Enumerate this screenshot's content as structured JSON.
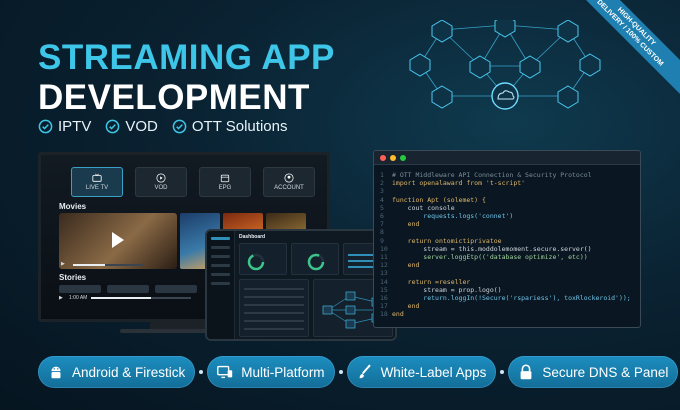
{
  "hero": {
    "title_line1": "STREAMING APP",
    "title_line2": "DEVELOPMENT"
  },
  "checks": [
    "IPTV",
    "VOD",
    "OTT Solutions"
  ],
  "ribbon": {
    "line1": "HIGH-QUALITY",
    "line2": "DELIVERY / 100% CUSTOM"
  },
  "tv": {
    "tabs": [
      {
        "label": "LIVE TV",
        "icon": "tv-icon",
        "active": true
      },
      {
        "label": "VOD",
        "icon": "play-icon",
        "active": false
      },
      {
        "label": "EPG",
        "icon": "calendar-icon",
        "active": false
      },
      {
        "label": "ACCOUNT",
        "icon": "user-icon",
        "active": false
      }
    ],
    "movies_label": "Movies",
    "stories_label": "Stories",
    "time": "1:00 AM",
    "playback_progress": 0.45,
    "stories_progress": 0.6
  },
  "dashboard": {
    "title": "Dashboard"
  },
  "code": {
    "lines": [
      {
        "n": "1",
        "t": "# OTT Middleware API Connection & Security Protocol",
        "cls": "c"
      },
      {
        "n": "2",
        "t": "import openalaward from 't-script'",
        "cls": "k"
      },
      {
        "n": "3",
        "t": "",
        "cls": ""
      },
      {
        "n": "4",
        "t": "function Apt (solemet) {",
        "cls": "k"
      },
      {
        "n": "5",
        "t": "    cout console",
        "cls": ""
      },
      {
        "n": "6",
        "t": "        requests.logs('connet')",
        "cls": "f"
      },
      {
        "n": "7",
        "t": "    end",
        "cls": "k"
      },
      {
        "n": "8",
        "t": "",
        "cls": ""
      },
      {
        "n": "9",
        "t": "    return ontomictiprivatoe",
        "cls": "k"
      },
      {
        "n": "10",
        "t": "        stream = this.moddolemoment.secure.server()",
        "cls": ""
      },
      {
        "n": "11",
        "t": "        server.loggEtp(('database optimize', etc))",
        "cls": "s"
      },
      {
        "n": "12",
        "t": "    end",
        "cls": "k"
      },
      {
        "n": "13",
        "t": "",
        "cls": ""
      },
      {
        "n": "14",
        "t": "    return =reseller",
        "cls": "k"
      },
      {
        "n": "15",
        "t": "        stream = prop.logo()",
        "cls": ""
      },
      {
        "n": "16",
        "t": "        return.loggIn(!Secure('rspariess'), toxRlockeroid'));",
        "cls": "f"
      },
      {
        "n": "17",
        "t": "    end",
        "cls": "k"
      },
      {
        "n": "18",
        "t": "end",
        "cls": "k"
      }
    ]
  },
  "pills": [
    {
      "label": "Android & Firestick",
      "icon": "android-icon"
    },
    {
      "label": "Multi-Platform",
      "icon": "monitor-icon"
    },
    {
      "label": "White-Label Apps",
      "icon": "brush-icon"
    },
    {
      "label": "Secure DNS & Panel",
      "icon": "lock-icon"
    }
  ],
  "colors": {
    "accent": "#3ec6e8",
    "pill": "#1a86b8",
    "background": "#0a2232"
  }
}
